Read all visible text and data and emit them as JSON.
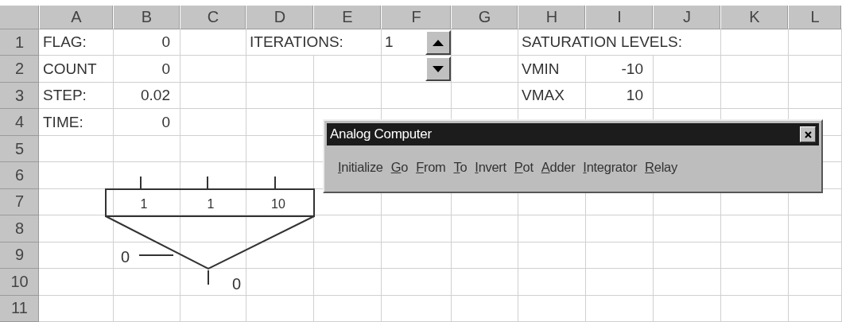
{
  "columns": [
    "A",
    "B",
    "C",
    "D",
    "E",
    "F",
    "G",
    "H",
    "I",
    "J",
    "K",
    "L"
  ],
  "rows": [
    {
      "label": "1",
      "cells": {
        "col_a": {
          "text": "FLAG:",
          "kind": "label"
        },
        "col_b": {
          "text": "0",
          "kind": "number"
        },
        "col_d": {
          "text": "ITERATIONS:",
          "kind": "label"
        },
        "col_f": {
          "text": "1",
          "kind": "label"
        },
        "col_h": {
          "text": "SATURATION LEVELS:",
          "kind": "label"
        }
      }
    },
    {
      "label": "2",
      "cells": {
        "col_a": {
          "text": "COUNT",
          "kind": "label"
        },
        "col_b": {
          "text": "0",
          "kind": "number"
        },
        "col_h": {
          "text": "VMIN",
          "kind": "label"
        },
        "col_i": {
          "text": "-10",
          "kind": "number"
        }
      }
    },
    {
      "label": "3",
      "cells": {
        "col_a": {
          "text": "STEP:",
          "kind": "label"
        },
        "col_b": {
          "text": "0.02",
          "kind": "number"
        },
        "col_h": {
          "text": "VMAX",
          "kind": "label"
        },
        "col_i": {
          "text": "10",
          "kind": "number"
        }
      }
    },
    {
      "label": "4",
      "cells": {
        "col_a": {
          "text": "TIME:",
          "kind": "label"
        },
        "col_b": {
          "text": "0",
          "kind": "number"
        }
      }
    },
    {
      "label": "5"
    },
    {
      "label": "6"
    },
    {
      "label": "7"
    },
    {
      "label": "8"
    },
    {
      "label": "9"
    },
    {
      "label": "10"
    },
    {
      "label": "11"
    }
  ],
  "toolbar": {
    "title": "Analog Computer",
    "buttons": [
      {
        "label": "Initialize",
        "underline_first": true
      },
      {
        "label": "Go",
        "underline_first": true
      },
      {
        "label": "From",
        "underline_first": true
      },
      {
        "label": "To",
        "underline_first": true
      },
      {
        "label": "Invert",
        "underline_first": true
      },
      {
        "label": "Pot",
        "underline_first": true
      },
      {
        "label": "Adder",
        "underline_first": true
      },
      {
        "label": "Integrator",
        "underline_first": true
      },
      {
        "label": "Relay",
        "underline_first": true
      }
    ]
  },
  "diagram": {
    "gains": [
      "1",
      "1",
      "10"
    ],
    "input": "0",
    "output": "0"
  }
}
